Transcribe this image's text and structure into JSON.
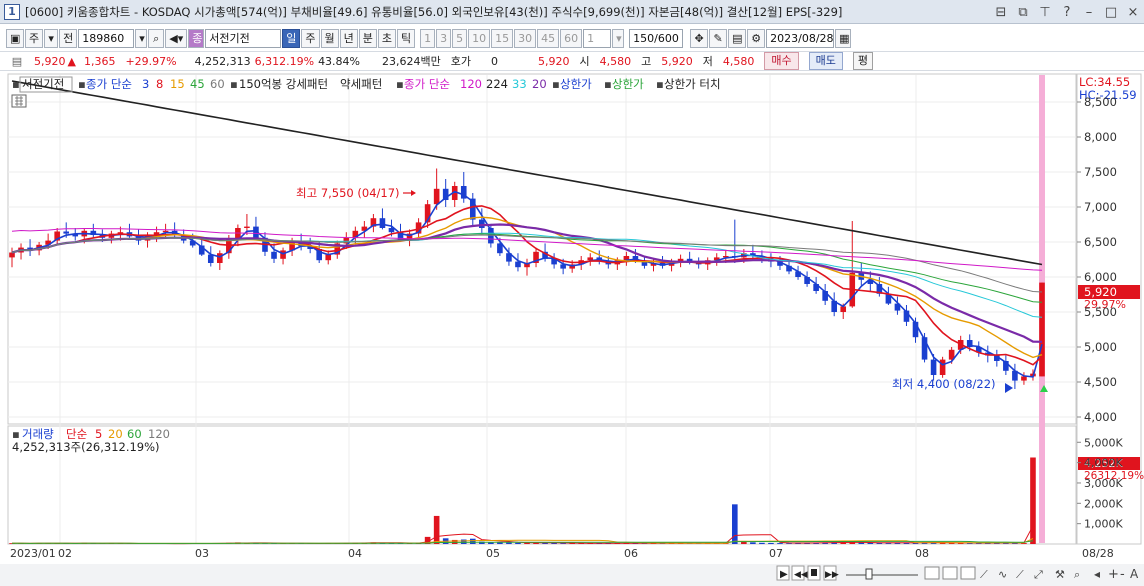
{
  "title_bar": {
    "badge": "1",
    "text": "[0600] 키움종합차트 - KOSDAQ 시가총액[574(억)] 부채비율[49.6] 유통비율[56.0] 외국인보유[43(천)] 주식수[9,699(천)] 자본금[48(억)] 결산[12월] EPS[-329]",
    "controls": [
      "⊟",
      "⧉",
      "⊤",
      "?",
      "–",
      "□",
      "×"
    ]
  },
  "toolbar": {
    "period_main": "주",
    "period_prev": "전",
    "code": "189860",
    "stock_name": "서전기전",
    "periods": [
      "일",
      "주",
      "월",
      "년",
      "분",
      "초",
      "틱"
    ],
    "selected_period": "일",
    "intervals": [
      "1",
      "3",
      "5",
      "10",
      "15",
      "30",
      "45",
      "60"
    ],
    "interval_value": "1",
    "count": "150/600",
    "date": "2023/08/28"
  },
  "quote": {
    "price": "5,920",
    "change": "1,365",
    "change_pct": "+29.97%",
    "volume": "4,252,313",
    "vol_ratio": "6,312.19%",
    "turnover": "43.84%",
    "amount": "23,624백만",
    "hoga_label": "호가",
    "hoga_value": "0",
    "price2": "5,920",
    "open_label": "시",
    "open": "4,580",
    "high_label": "고",
    "high": "5,920",
    "low_label": "저",
    "low": "4,580",
    "buy": "매수",
    "sell": "매도",
    "avg": "평"
  },
  "legend": {
    "name": "서전기전",
    "ma_label": "종가 단순",
    "ma": [
      "3",
      "8",
      "15",
      "45",
      "60"
    ],
    "ma_colors": [
      "#1a3fd0",
      "#e0141e",
      "#e69b00",
      "#2ba53a",
      "#7a7a7a"
    ],
    "pattern": "150억봉 강세패턴",
    "weak": "약세패턴",
    "ma2_label": "종가 단순",
    "ma2": [
      "120",
      "224",
      "33",
      "20"
    ],
    "ma2_colors": [
      "#d019c8",
      "#222222",
      "#27c8d8",
      "#7a2aa8"
    ],
    "upper": "상한가",
    "upper2": "상한가",
    "upper_touch": "상한가 터치"
  },
  "chart_data": {
    "type": "candlestick",
    "y_ticks": [
      "8,500",
      "8,000",
      "7,500",
      "7,000",
      "6,500",
      "6,000",
      "5,500",
      "5,000",
      "4,500",
      "4,000"
    ],
    "y_tick_values": [
      8500,
      8000,
      7500,
      7000,
      6500,
      6000,
      5500,
      5000,
      4500,
      4000
    ],
    "ylim": [
      3900,
      8900
    ],
    "lc": "LC:34.55",
    "hc": "HC:-21.59",
    "last_price": "5,920",
    "last_pct": "29.97%",
    "high_annotation": "최고 7,550 (04/17)",
    "low_annotation": "최저 4,400 (08/22)",
    "x_labels": [
      "2023/01",
      "02",
      "03",
      "04",
      "05",
      "06",
      "07",
      "08",
      "08/28"
    ],
    "ohlc": [
      [
        6280,
        6420,
        6140,
        6350
      ],
      [
        6350,
        6480,
        6250,
        6420
      ],
      [
        6420,
        6540,
        6300,
        6380
      ],
      [
        6380,
        6500,
        6310,
        6460
      ],
      [
        6460,
        6620,
        6400,
        6520
      ],
      [
        6520,
        6700,
        6460,
        6650
      ],
      [
        6650,
        6780,
        6560,
        6620
      ],
      [
        6620,
        6700,
        6520,
        6580
      ],
      [
        6580,
        6700,
        6480,
        6660
      ],
      [
        6660,
        6760,
        6560,
        6600
      ],
      [
        6600,
        6680,
        6500,
        6560
      ],
      [
        6560,
        6660,
        6480,
        6620
      ],
      [
        6620,
        6720,
        6520,
        6640
      ],
      [
        6640,
        6760,
        6560,
        6580
      ],
      [
        6580,
        6680,
        6460,
        6520
      ],
      [
        6520,
        6640,
        6420,
        6600
      ],
      [
        6600,
        6720,
        6500,
        6640
      ],
      [
        6640,
        6760,
        6560,
        6660
      ],
      [
        6660,
        6780,
        6560,
        6600
      ],
      [
        6600,
        6680,
        6480,
        6520
      ],
      [
        6520,
        6620,
        6420,
        6450
      ],
      [
        6450,
        6560,
        6300,
        6320
      ],
      [
        6320,
        6440,
        6150,
        6200
      ],
      [
        6200,
        6380,
        6100,
        6340
      ],
      [
        6340,
        6600,
        6260,
        6540
      ],
      [
        6540,
        6750,
        6440,
        6700
      ],
      [
        6700,
        6900,
        6600,
        6720
      ],
      [
        6720,
        6860,
        6540,
        6560
      ],
      [
        6560,
        6640,
        6300,
        6360
      ],
      [
        6360,
        6480,
        6200,
        6260
      ],
      [
        6260,
        6420,
        6180,
        6380
      ],
      [
        6380,
        6560,
        6300,
        6500
      ],
      [
        6500,
        6620,
        6380,
        6440
      ],
      [
        6440,
        6560,
        6340,
        6400
      ],
      [
        6400,
        6500,
        6200,
        6240
      ],
      [
        6240,
        6380,
        6180,
        6320
      ],
      [
        6320,
        6520,
        6260,
        6480
      ],
      [
        6480,
        6640,
        6400,
        6560
      ],
      [
        6560,
        6720,
        6480,
        6660
      ],
      [
        6660,
        6800,
        6560,
        6720
      ],
      [
        6720,
        6900,
        6640,
        6840
      ],
      [
        6840,
        6980,
        6680,
        6700
      ],
      [
        6700,
        6820,
        6580,
        6640
      ],
      [
        6640,
        6760,
        6500,
        6520
      ],
      [
        6520,
        6680,
        6440,
        6620
      ],
      [
        6620,
        6840,
        6560,
        6780
      ],
      [
        6780,
        7100,
        6700,
        7040
      ],
      [
        7040,
        7550,
        6960,
        7260
      ],
      [
        7260,
        7400,
        7000,
        7100
      ],
      [
        7100,
        7360,
        7000,
        7300
      ],
      [
        7300,
        7500,
        7060,
        7120
      ],
      [
        7120,
        7200,
        6740,
        6820
      ],
      [
        6820,
        6980,
        6620,
        6700
      ],
      [
        6700,
        6760,
        6420,
        6480
      ],
      [
        6480,
        6560,
        6300,
        6340
      ],
      [
        6340,
        6420,
        6160,
        6220
      ],
      [
        6220,
        6340,
        6080,
        6140
      ],
      [
        6140,
        6260,
        6020,
        6200
      ],
      [
        6200,
        6420,
        6140,
        6360
      ],
      [
        6360,
        6480,
        6220,
        6260
      ],
      [
        6260,
        6340,
        6120,
        6180
      ],
      [
        6180,
        6260,
        6040,
        6120
      ],
      [
        6120,
        6240,
        6060,
        6180
      ],
      [
        6180,
        6300,
        6100,
        6240
      ],
      [
        6240,
        6340,
        6160,
        6280
      ],
      [
        6280,
        6380,
        6180,
        6220
      ],
      [
        6220,
        6300,
        6120,
        6180
      ],
      [
        6180,
        6280,
        6100,
        6240
      ],
      [
        6240,
        6360,
        6160,
        6300
      ],
      [
        6300,
        6400,
        6200,
        6220
      ],
      [
        6220,
        6300,
        6120,
        6160
      ],
      [
        6160,
        6260,
        6080,
        6200
      ],
      [
        6200,
        6300,
        6120,
        6160
      ],
      [
        6160,
        6260,
        6080,
        6220
      ],
      [
        6220,
        6320,
        6140,
        6260
      ],
      [
        6260,
        6360,
        6180,
        6200
      ],
      [
        6200,
        6280,
        6120,
        6180
      ],
      [
        6180,
        6280,
        6100,
        6240
      ],
      [
        6240,
        6340,
        6160,
        6280
      ],
      [
        6280,
        6380,
        6200,
        6300
      ],
      [
        6300,
        6820,
        6200,
        6280
      ],
      [
        6280,
        6400,
        6200,
        6340
      ],
      [
        6340,
        6460,
        6240,
        6300
      ],
      [
        6300,
        6380,
        6200,
        6260
      ],
      [
        6260,
        6340,
        6140,
        6220
      ],
      [
        6220,
        6300,
        6100,
        6160
      ],
      [
        6160,
        6240,
        6040,
        6080
      ],
      [
        6080,
        6160,
        5960,
        6000
      ],
      [
        6000,
        6080,
        5860,
        5900
      ],
      [
        5900,
        6000,
        5760,
        5800
      ],
      [
        5800,
        5900,
        5600,
        5660
      ],
      [
        5660,
        5780,
        5440,
        5500
      ],
      [
        5500,
        5620,
        5400,
        5580
      ],
      [
        5580,
        6800,
        5560,
        6060
      ],
      [
        6060,
        6200,
        5880,
        5960
      ],
      [
        5960,
        6080,
        5800,
        5900
      ],
      [
        5900,
        6000,
        5720,
        5760
      ],
      [
        5760,
        5860,
        5600,
        5620
      ],
      [
        5620,
        5720,
        5460,
        5520
      ],
      [
        5520,
        5600,
        5300,
        5360
      ],
      [
        5360,
        5420,
        5060,
        5140
      ],
      [
        5140,
        5200,
        4780,
        4820
      ],
      [
        4820,
        4900,
        4520,
        4600
      ],
      [
        4600,
        4860,
        4560,
        4820
      ],
      [
        4820,
        5000,
        4760,
        4960
      ],
      [
        4960,
        5160,
        4900,
        5100
      ],
      [
        5100,
        5180,
        4940,
        5000
      ],
      [
        5000,
        5080,
        4860,
        4920
      ],
      [
        4920,
        5020,
        4780,
        4880
      ],
      [
        4880,
        4960,
        4720,
        4800
      ],
      [
        4800,
        4880,
        4600,
        4660
      ],
      [
        4660,
        4760,
        4400,
        4520
      ],
      [
        4520,
        4640,
        4460,
        4580
      ],
      [
        4580,
        4680,
        4520,
        4620
      ],
      [
        4580,
        5920,
        4580,
        5920
      ]
    ],
    "volume_ticks": [
      "5,000K",
      "4,000K",
      "3,000K",
      "2,000K",
      "1,000K"
    ],
    "volume_tick_values": [
      5000,
      4000,
      3000,
      2000,
      1000
    ],
    "volume_max": 5800,
    "volume_last": "4,252K",
    "volume_last_pct": "26312.19%",
    "volume_legend_label": "거래량",
    "volume_ma_label": "단순",
    "volume_ma": [
      "5",
      "20",
      "60",
      "120"
    ],
    "volume_ma_colors": [
      "#e0141e",
      "#e69b00",
      "#2ba53a",
      "#7a7a7a"
    ],
    "volume_header": "4,252,313주(26,312.19%)",
    "volume": [
      40,
      30,
      25,
      35,
      50,
      30,
      20,
      25,
      60,
      30,
      20,
      25,
      30,
      35,
      20,
      15,
      25,
      30,
      20,
      15,
      25,
      40,
      35,
      30,
      60,
      80,
      50,
      40,
      45,
      30,
      25,
      30,
      35,
      20,
      25,
      30,
      40,
      50,
      60,
      70,
      80,
      60,
      40,
      35,
      30,
      60,
      350,
      1380,
      280,
      200,
      220,
      260,
      120,
      90,
      80,
      70,
      60,
      50,
      70,
      60,
      50,
      40,
      35,
      30,
      40,
      35,
      30,
      45,
      40,
      35,
      30,
      35,
      40,
      30,
      25,
      30,
      35,
      40,
      30,
      35,
      1950,
      150,
      80,
      60,
      50,
      45,
      40,
      55,
      60,
      70,
      80,
      90,
      60,
      85,
      70,
      60,
      50,
      45,
      60,
      70,
      80,
      90,
      70,
      60,
      55,
      50,
      45,
      40,
      50,
      60,
      70,
      50,
      45,
      4252
    ]
  }
}
